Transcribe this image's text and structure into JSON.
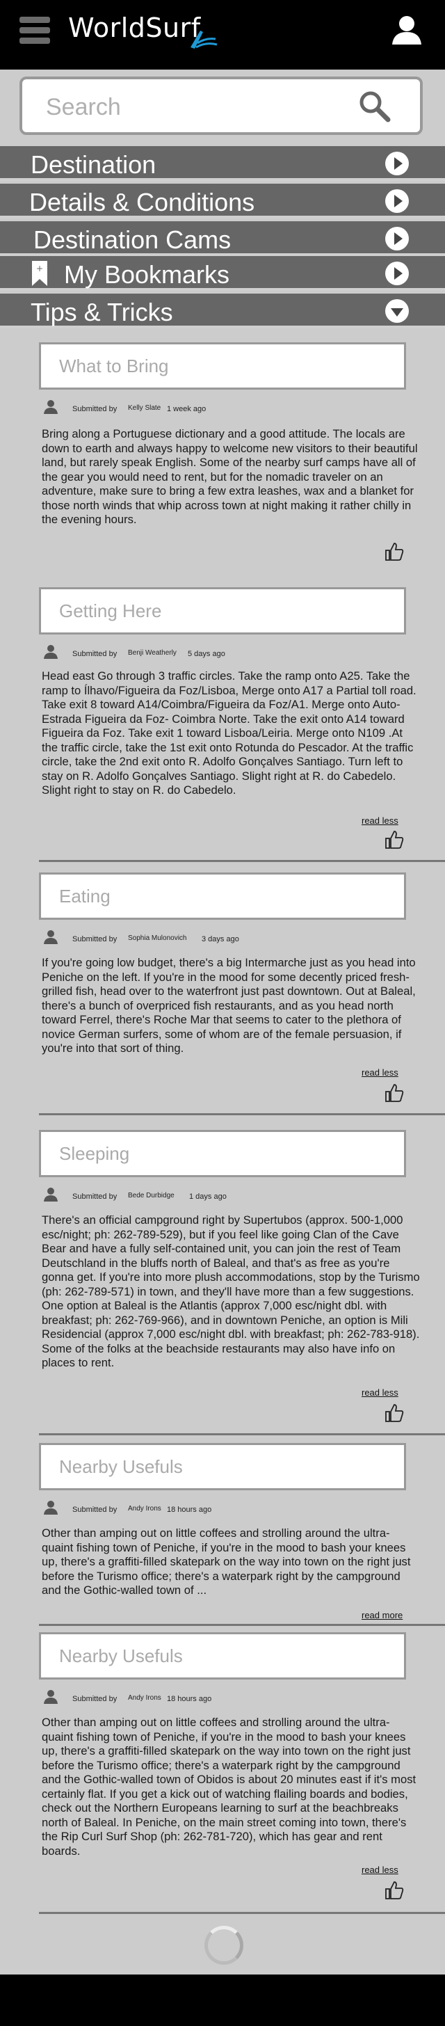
{
  "app": {
    "title": "WorldSurf"
  },
  "search": {
    "placeholder": "Search"
  },
  "menu": [
    {
      "label": "Destination",
      "state": "collapsed"
    },
    {
      "label": "Details & Conditions",
      "state": "collapsed"
    },
    {
      "label": "Destination Cams",
      "state": "collapsed"
    },
    {
      "label": "My Bookmarks",
      "state": "collapsed"
    },
    {
      "label": "Tips & Tricks",
      "state": "expanded"
    }
  ],
  "tips": [
    {
      "title": "What to Bring",
      "submitted_by": "Submitted by",
      "author": "Kelly Slate",
      "age": "1 week ago",
      "text": "Bring along a Portuguese dictionary and a good attitude. The locals are down to earth and always happy to welcome new visitors to their beautiful land, but rarely speak English. Some of the nearby surf camps have all of the gear you would need to rent, but for the nomadic traveler on an adventure, make sure to bring a few extra leashes, wax and a blanket for those north winds that whip across town at night making it rather chilly in the evening hours.",
      "link": ""
    },
    {
      "title": "Getting Here",
      "submitted_by": "Submitted by",
      "author": "Benji Weatherly",
      "age": "5 days  ago",
      "text": "Head east Go through 3 traffic circles. Take the ramp onto A25. Take the ramp to Ílhavo/Figueira da Foz/Lisboa, Merge onto A17 a Partial toll road. Take exit 8 toward A14/Coimbra/Figueira da Foz/A1. Merge onto Auto-Estrada Figueira da Foz- Coimbra Norte. Take the exit onto A14 toward Figueira da Foz. Take exit 1 toward Lisboa/Leiria. Merge onto N109 .At the traffic circle, take the 1st exit onto Rotunda do Pescador. At the traffic circle, take the 2nd exit onto R. Adolfo Gonçalves Santiago. Turn left to stay on R. Adolfo Gonçalves Santiago. Slight right at R. do Cabedelo. Slight right to stay on R. do Cabedelo.",
      "link": "read less"
    },
    {
      "title": "Eating",
      "submitted_by": "Submitted by",
      "author": "Sophia Mulonovich",
      "age": "3 days  ago",
      "text": "If you're going low budget, there's a big Intermarche just as you head into Peniche on the left. If you're in the mood for some decently priced fresh-grilled fish, head over to the waterfront just past downtown. Out at Baleal, there's a bunch of overpriced fish restaurants, and as you head north toward Ferrel, there's Roche Mar that seems to cater to the plethora of novice German surfers, some of whom are of the female persuasion, if you're into that sort of thing.",
      "link": "read less"
    },
    {
      "title": "Sleeping",
      "submitted_by": "Submitted by",
      "author": "Bede Durbidge",
      "age": "1 days  ago",
      "text": "There's an official campground right by Supertubos (approx. 500-1,000 esc/night; ph: 262-789-529), but if you feel like going Clan of the Cave Bear and have a fully self-contained unit, you can join the rest of Team Deutschland in the bluffs north of Baleal, and that's as free as you're gonna get. If you're into more plush accommodations, stop by the Turismo (ph: 262-789-571) in town, and they'll have more than a few suggestions. One option at Baleal is the Atlantis (approx 7,000 esc/night dbl. with breakfast; ph: 262-769-966), and in downtown Peniche, an option is Mili Residencial (approx 7,000 esc/night dbl. with breakfast; ph: 262-783-918). Some of the folks at the beachside restaurants may also have info on places to rent.",
      "link": "read less"
    },
    {
      "title": "Nearby Usefuls",
      "submitted_by": "Submitted by",
      "author": "Andy Irons",
      "age": "18 hours  ago",
      "text": "Other than amping out on little coffees and strolling around the ultra-quaint fishing town of Peniche, if you're in the mood to bash your knees up, there's a graffiti-filled skatepark on the way into town on the right just before the Turismo office; there's a waterpark right by the campground and the Gothic-walled town of ...",
      "link": "read more"
    },
    {
      "title": "Nearby Usefuls",
      "submitted_by": "Submitted by",
      "author": "Andy Irons",
      "age": "18 hours  ago",
      "text": "Other than amping out on little coffees and strolling around the ultra-quaint fishing town of Peniche, if you're in the mood to bash your knees up, there's a graffiti-filled skatepark on the way into town on the right just before the Turismo office; there's a waterpark right by the campground and the Gothic-walled town of Obidos is about 20 minutes east if it's most certainly flat. If you get a kick out of watching flailing boards and bodies, check out the Northern Europeans learning to surf at the beachbreaks north of Baleal. In Peniche, on the main street coming into town, there's the Rip Curl Surf Shop (ph: 262-781-720), which has gear and rent boards.",
      "link": "read less"
    }
  ]
}
